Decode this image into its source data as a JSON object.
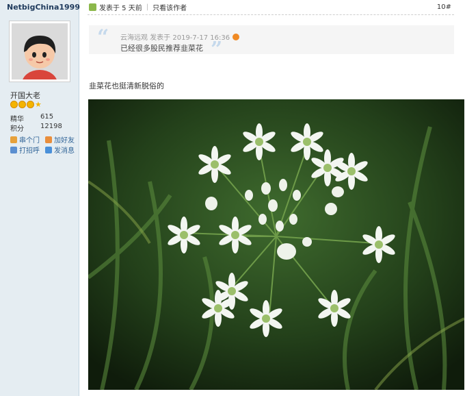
{
  "author": {
    "username": "NetbigChina1999",
    "rank": "开国大老",
    "stats": [
      {
        "label": "精华",
        "value": "615"
      },
      {
        "label": "积分",
        "value": "12198"
      }
    ],
    "actions": [
      {
        "label": "串个门",
        "icon": "house-icon"
      },
      {
        "label": "加好友",
        "icon": "add-friend-icon"
      },
      {
        "label": "打招呼",
        "icon": "wave-icon"
      },
      {
        "label": "发消息",
        "icon": "message-icon"
      }
    ]
  },
  "post": {
    "posted": "发表于 5 天前",
    "only_author": "只看该作者",
    "floor": "10#",
    "quote": {
      "meta": "云海远观 发表于 2019-7-17 16:36",
      "text": "已经很多股民推荐韭菜花"
    },
    "body": "韭菜花也挺清新脱俗的"
  },
  "colors": {
    "sidebar_bg": "#e5edf2",
    "link": "#336699",
    "quote_bg": "#f5f5f5"
  }
}
